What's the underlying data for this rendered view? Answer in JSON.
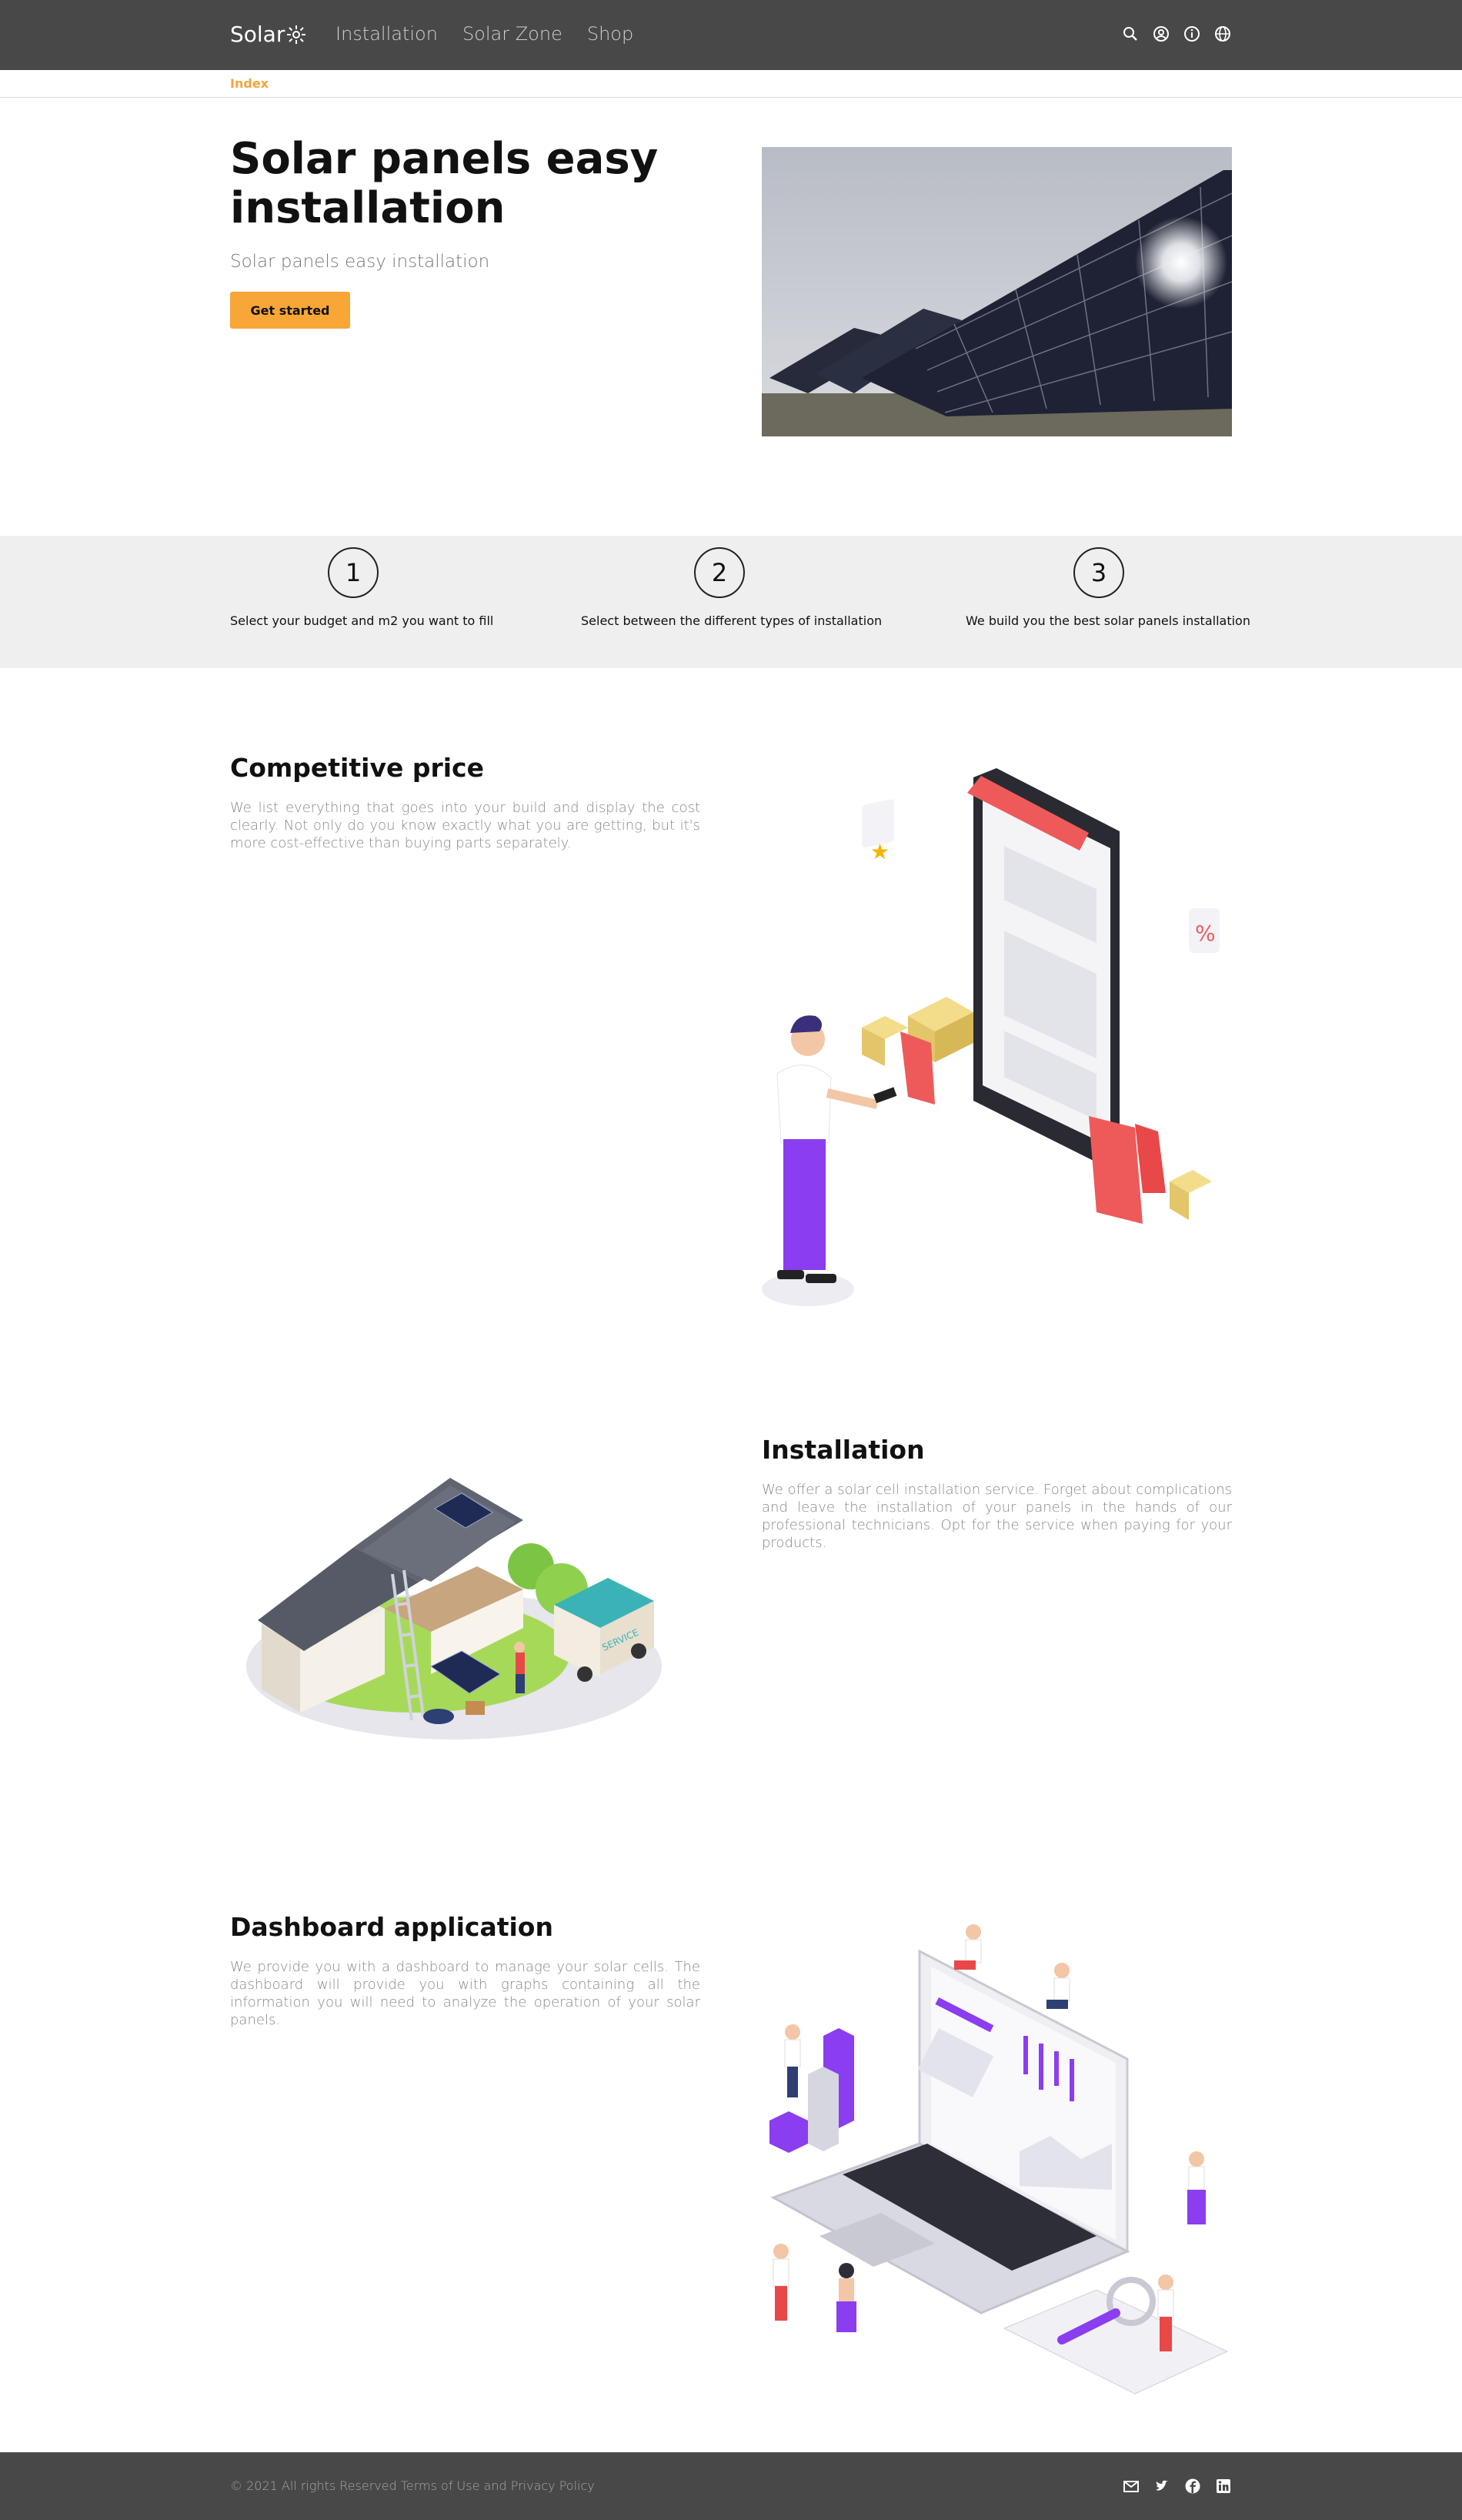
{
  "header": {
    "logo": "Solar",
    "nav": [
      "Installation",
      "Solar Zone",
      "Shop"
    ],
    "icons": [
      "search-icon",
      "user-icon",
      "info-icon",
      "globe-icon"
    ]
  },
  "breadcrumb": "Index",
  "hero": {
    "title": "Solar panels easy installation",
    "subtitle": "Solar panels easy installation",
    "cta": "Get started"
  },
  "steps": [
    {
      "number": "1",
      "text": "Select your budget and m2 you want to fill"
    },
    {
      "number": "2",
      "text": "Select between the different types of installation"
    },
    {
      "number": "3",
      "text": "We build you the best solar panels installation"
    }
  ],
  "features": [
    {
      "title": "Competitive price",
      "body": "We list everything that goes into your build and display the cost clearly. Not only do you know exactly what you are getting, but it's more cost-effective than buying parts separately."
    },
    {
      "title": "Installation",
      "body": "We offer a solar cell installation service. Forget about complications and leave the installation of your panels in the hands of our professional technicians. Opt for the service when paying for your products."
    },
    {
      "title": "Dashboard application",
      "body": "We provide you with a dashboard to manage your solar cells. The dashboard will provide you with graphs containing all the information you will need to analyze the operation of your solar panels."
    }
  ],
  "footer": {
    "copyright": "© 2021 All rights Reserved Terms of Use and Privacy Policy",
    "social": [
      "mail-icon",
      "twitter-icon",
      "facebook-icon",
      "linkedin-icon"
    ]
  },
  "colors": {
    "header_bg": "#484848",
    "accent": "#f8a637",
    "steps_bg": "#efefef"
  }
}
